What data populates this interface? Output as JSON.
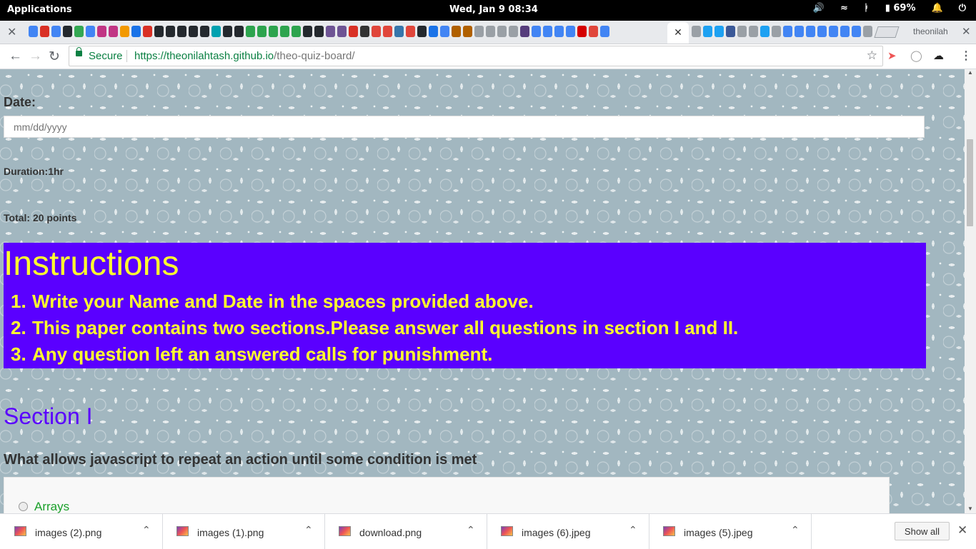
{
  "os_bar": {
    "menu_label": "Applications",
    "clock": "Wed, Jan  9    08:34",
    "battery": "69%"
  },
  "tab_strip": {
    "profile_name": "theonilah",
    "favicons_left": [
      "G",
      "M",
      "G",
      "git",
      "chrome",
      "G",
      "ig",
      "ig",
      "o",
      "x",
      "M",
      "git",
      "git",
      "git",
      "git",
      "git",
      "D",
      "git",
      "git",
      "ex",
      "ex",
      "ex",
      "ex",
      "ex",
      "git",
      "git",
      "gx",
      "gx",
      "M",
      "#",
      "an",
      "an",
      "py",
      "an",
      "git",
      "x",
      "G",
      "b",
      "b",
      "doc",
      "doc",
      "doc",
      "doc",
      "B",
      "G",
      "G",
      "G",
      "G",
      "red",
      "an",
      "G"
    ],
    "favicons_right": [
      "doc",
      "tw",
      "tw",
      "fb",
      "doc",
      "doc",
      "tw",
      "doc",
      "G",
      "G",
      "G",
      "G",
      "G",
      "G",
      "G",
      "doc"
    ]
  },
  "toolbar": {
    "secure_label": "Secure",
    "url_host": "https://theonilahtash.github.io",
    "url_path": "/theo-quiz-board/"
  },
  "page": {
    "date_label": "Date:",
    "date_placeholder": "mm/dd/yyyy",
    "duration": "Duration:1hr",
    "total": "Total: 20 points",
    "instructions_title": "Instructions",
    "instructions": [
      {
        "num": "1.",
        "text": "Write your Name and Date in the spaces provided above."
      },
      {
        "num": "2.",
        "text": "This paper contains two sections.Please answer all questions in section I and II."
      },
      {
        "num": "3.",
        "text": "Any question left an answered calls for punishment."
      }
    ],
    "section_title": "Section I",
    "question": "What allows javascript to repeat an action until some condition is met",
    "option_1": "Arrays"
  },
  "downloads": {
    "items": [
      "images (2).png",
      "images (1).png",
      "download.png",
      "images (6).jpeg",
      "images (5).jpeg"
    ],
    "show_all": "Show all"
  },
  "colors": {
    "instructions_bg": "#5a00ff",
    "instructions_text": "#ffff2e",
    "section_title": "#5a00ff",
    "option_text": "#1aa02a",
    "secure_green": "#0b8043"
  }
}
